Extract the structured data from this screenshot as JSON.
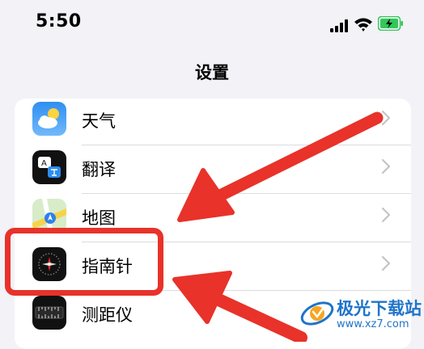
{
  "status_bar": {
    "time": "5:50"
  },
  "header": {
    "title": "设置"
  },
  "settings": {
    "items": [
      {
        "label": "天气",
        "icon": "weather-icon"
      },
      {
        "label": "翻译",
        "icon": "translate-icon"
      },
      {
        "label": "地图",
        "icon": "maps-icon"
      },
      {
        "label": "指南针",
        "icon": "compass-icon"
      },
      {
        "label": "测距仪",
        "icon": "measure-icon"
      }
    ]
  },
  "annotations": {
    "color": "#e8322a",
    "highlighted_item": "指南针"
  },
  "watermark": {
    "name": "极光下载站",
    "url": "www.xz7.com"
  },
  "colors": {
    "background": "#f2f2f7",
    "battery": "#32c759",
    "accent_red": "#e8322a"
  }
}
